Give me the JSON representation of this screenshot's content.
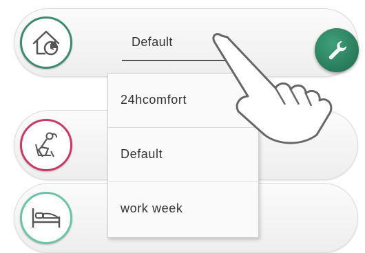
{
  "selector": {
    "value": "Default"
  },
  "dropdown": {
    "options": [
      "24hcomfort",
      "Default",
      "work week"
    ]
  },
  "icons": {
    "row1": "house-clock-icon",
    "row2": "reclining-person-icon",
    "row3": "bed-icon",
    "tool": "wrench-icon",
    "pointer": "hand-pointer-icon"
  },
  "colors": {
    "row1_ring": "#3e8a6e",
    "row2_ring": "#c83a64",
    "row3_ring": "#6cc4a4",
    "tool_button": "#2b8463"
  }
}
